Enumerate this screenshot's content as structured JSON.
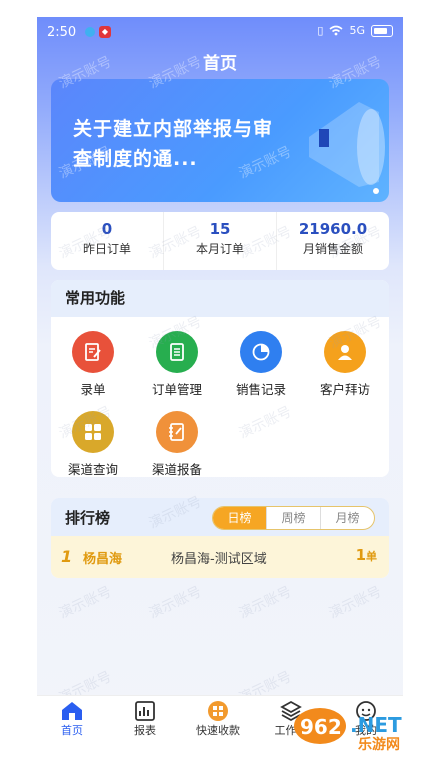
{
  "status": {
    "time": "2:50",
    "signal": "5G"
  },
  "header": {
    "title": "首页"
  },
  "banner": {
    "text": "关于建立内部举报与审查制度的通..."
  },
  "stats": [
    {
      "value": "0",
      "label": "昨日订单"
    },
    {
      "value": "15",
      "label": "本月订单"
    },
    {
      "value": "21960.0",
      "label": "月销售金额"
    }
  ],
  "functions": {
    "title": "常用功能",
    "items": [
      {
        "label": "录单",
        "icon": "edit-icon",
        "color": "#e8513a"
      },
      {
        "label": "订单管理",
        "icon": "document-icon",
        "color": "#27ae4f"
      },
      {
        "label": "销售记录",
        "icon": "pie-chart-icon",
        "color": "#2f7ff0"
      },
      {
        "label": "客户拜访",
        "icon": "person-icon",
        "color": "#f5a11c"
      },
      {
        "label": "渠道查询",
        "icon": "grid-icon",
        "color": "#d9a82a"
      },
      {
        "label": "渠道报备",
        "icon": "notebook-icon",
        "color": "#f0913a"
      }
    ]
  },
  "ranking": {
    "title": "排行榜",
    "tabs": [
      "日榜",
      "周榜",
      "月榜"
    ],
    "active_tab": "日榜",
    "rows": [
      {
        "rank": "1",
        "name": "杨昌海",
        "area": "杨昌海-测试区域",
        "count": "1",
        "unit": "单"
      }
    ]
  },
  "nav": [
    {
      "label": "首页",
      "icon": "home-icon"
    },
    {
      "label": "报表",
      "icon": "report-icon"
    },
    {
      "label": "快速收款",
      "icon": "qrcode-icon"
    },
    {
      "label": "工作台",
      "icon": "layers-icon"
    },
    {
      "label": "我的",
      "icon": "profile-icon"
    }
  ],
  "watermark": "演示账号",
  "site_logo": {
    "number": "962",
    "suffix": ".NET",
    "tagline": "乐游网"
  },
  "colors": {
    "primary": "#2a5ef0",
    "accent": "#f6a623",
    "rank_gold": "#e09a10"
  }
}
